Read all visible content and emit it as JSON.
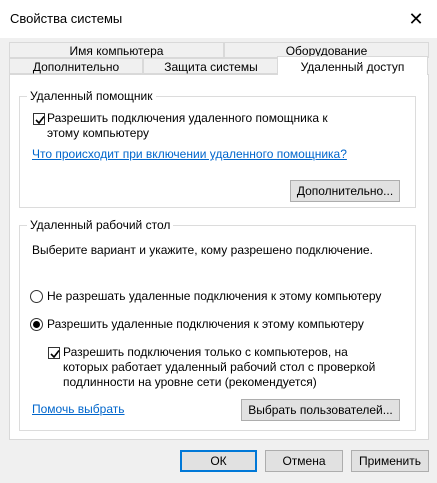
{
  "window": {
    "title": "Свойства системы",
    "close_glyph": "✕"
  },
  "tabs": {
    "row1": [
      "Имя компьютера",
      "Оборудование"
    ],
    "row2": [
      "Дополнительно",
      "Защита системы",
      "Удаленный доступ"
    ],
    "active": "Удаленный доступ"
  },
  "remote_assistance": {
    "legend": "Удаленный помощник",
    "allow_checkbox": {
      "label": "Разрешить подключения удаленного помощника к этому компьютеру",
      "checked": true
    },
    "help_link": "Что происходит при включении удаленного помощника?",
    "advanced_button": "Дополнительно..."
  },
  "remote_desktop": {
    "legend": "Удаленный рабочий стол",
    "instruction": "Выберите вариант и укажите, кому разрешено подключение.",
    "options": [
      {
        "label": "Не разрешать удаленные подключения к этому компьютеру",
        "selected": false
      },
      {
        "label": "Разрешить удаленные подключения к этому компьютеру",
        "selected": true
      }
    ],
    "nla_checkbox": {
      "label": "Разрешить подключения только с компьютеров, на которых работает удаленный рабочий стол с проверкой подлинности на уровне сети (рекомендуется)",
      "checked": true
    },
    "help_link": "Помочь выбрать",
    "select_users_button": "Выбрать пользователей..."
  },
  "footer": {
    "ok": "ОК",
    "cancel": "Отмена",
    "apply": "Применить"
  },
  "colors": {
    "link": "#0066cc",
    "default_button_border": "#0078d7"
  }
}
